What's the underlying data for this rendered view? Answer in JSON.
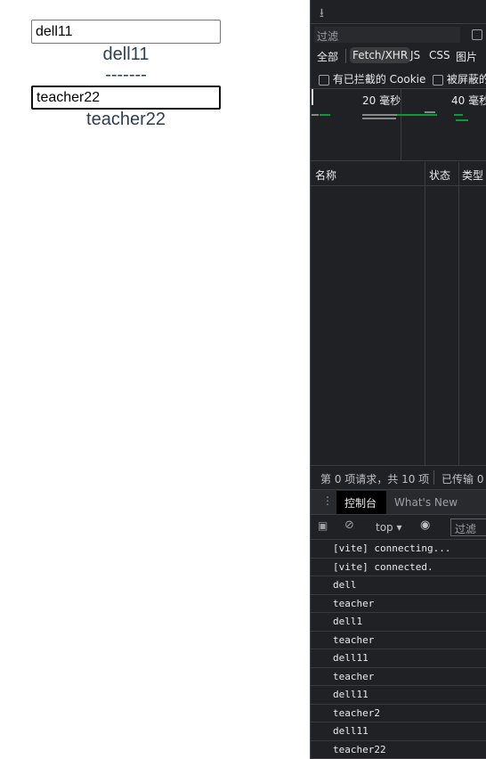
{
  "app": {
    "input1_value": "dell11",
    "echo1": "dell11",
    "separator": "-------",
    "input2_value": "teacher22",
    "echo2": "teacher22"
  },
  "devtools": {
    "filter_placeholder": "过滤",
    "type_filters": [
      "全部",
      "Fetch/XHR",
      "JS",
      "CSS",
      "图片"
    ],
    "active_type": "Fetch/XHR",
    "blocked_cookie_label": "有已拦截的 Cookie",
    "blocked_requests_label": "被屏蔽的",
    "timeline_ticks": [
      "20 毫秒",
      "40 毫秒"
    ],
    "columns": [
      "名称",
      "状态",
      "类型"
    ],
    "status_requests": "第 0 项请求，共 10 项",
    "status_transferred": "已传输 0",
    "drawer_tabs": [
      "控制台",
      "What's New"
    ],
    "active_drawer_tab": "控制台",
    "context": "top",
    "console_filter_placeholder": "过滤",
    "console_lines": [
      "[vite] connecting...",
      "[vite] connected.",
      "dell",
      "teacher",
      "dell1",
      "teacher",
      "dell11",
      "teacher",
      "dell11",
      "teacher2",
      "dell11",
      "teacher22"
    ]
  }
}
